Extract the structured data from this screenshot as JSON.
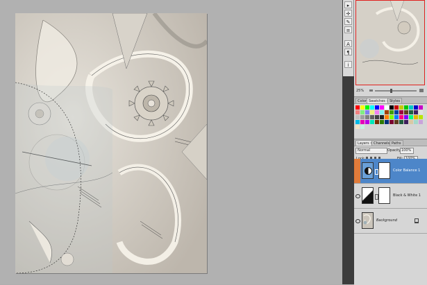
{
  "navigator": {
    "zoom": "25%"
  },
  "swatches_panel": {
    "tabs": [
      "Color",
      "Swatches ×",
      "Styles"
    ],
    "active_tab": 1,
    "colors": [
      "#ff0000",
      "#ffff00",
      "#00ff00",
      "#00ffff",
      "#0000ff",
      "#ff00ff",
      "#ffffff",
      "#000000",
      "#c80000",
      "#c8c800",
      "#00c800",
      "#00c8c8",
      "#0000c8",
      "#c800c8",
      "#f08080",
      "#80f080",
      "#8080f0",
      "#f0f080",
      "#f080f0",
      "#80f0f0",
      "#a04000",
      "#40a000",
      "#0040a0",
      "#a00040",
      "#604020",
      "#206040",
      "#402060",
      "#e0e0e0",
      "#c0c0c0",
      "#a0a0a0",
      "#808080",
      "#606060",
      "#404040",
      "#202020",
      "#ff8000",
      "#80ff00",
      "#0080ff",
      "#ff0080",
      "#8000ff",
      "#00ff80",
      "#e6b800",
      "#b8e600",
      "#00b8e6",
      "#e600b8",
      "#b800e6",
      "#00e6b8",
      "#7a2e00",
      "#2e7a00",
      "#002e7a",
      "#7a002e",
      "#5c3d1e",
      "#1e5c3d",
      "#3d1e5c",
      "#d9c9a3",
      "#a3d9c9",
      "#c9a3d9",
      "#f2e3c6",
      "#c6f2e3"
    ]
  },
  "layers_panel": {
    "tabs": [
      "Layers ×",
      "Channels",
      "Paths"
    ],
    "active_tab": 0,
    "blend_mode": "Normal",
    "opacity_label": "Opacity:",
    "opacity_value": "100%",
    "lock_label": "Lock:",
    "fill_label": "Fill:",
    "fill_value": "100%",
    "layers": [
      {
        "name": "Color Balance 1",
        "selected": true
      },
      {
        "name": "Black & White 1",
        "selected": false
      },
      {
        "name": "Background",
        "selected": false,
        "italic": true
      }
    ]
  },
  "colors": {
    "selection": "#5a8fd0",
    "panel": "#d4d4d4",
    "accent": "#e07b3a"
  }
}
